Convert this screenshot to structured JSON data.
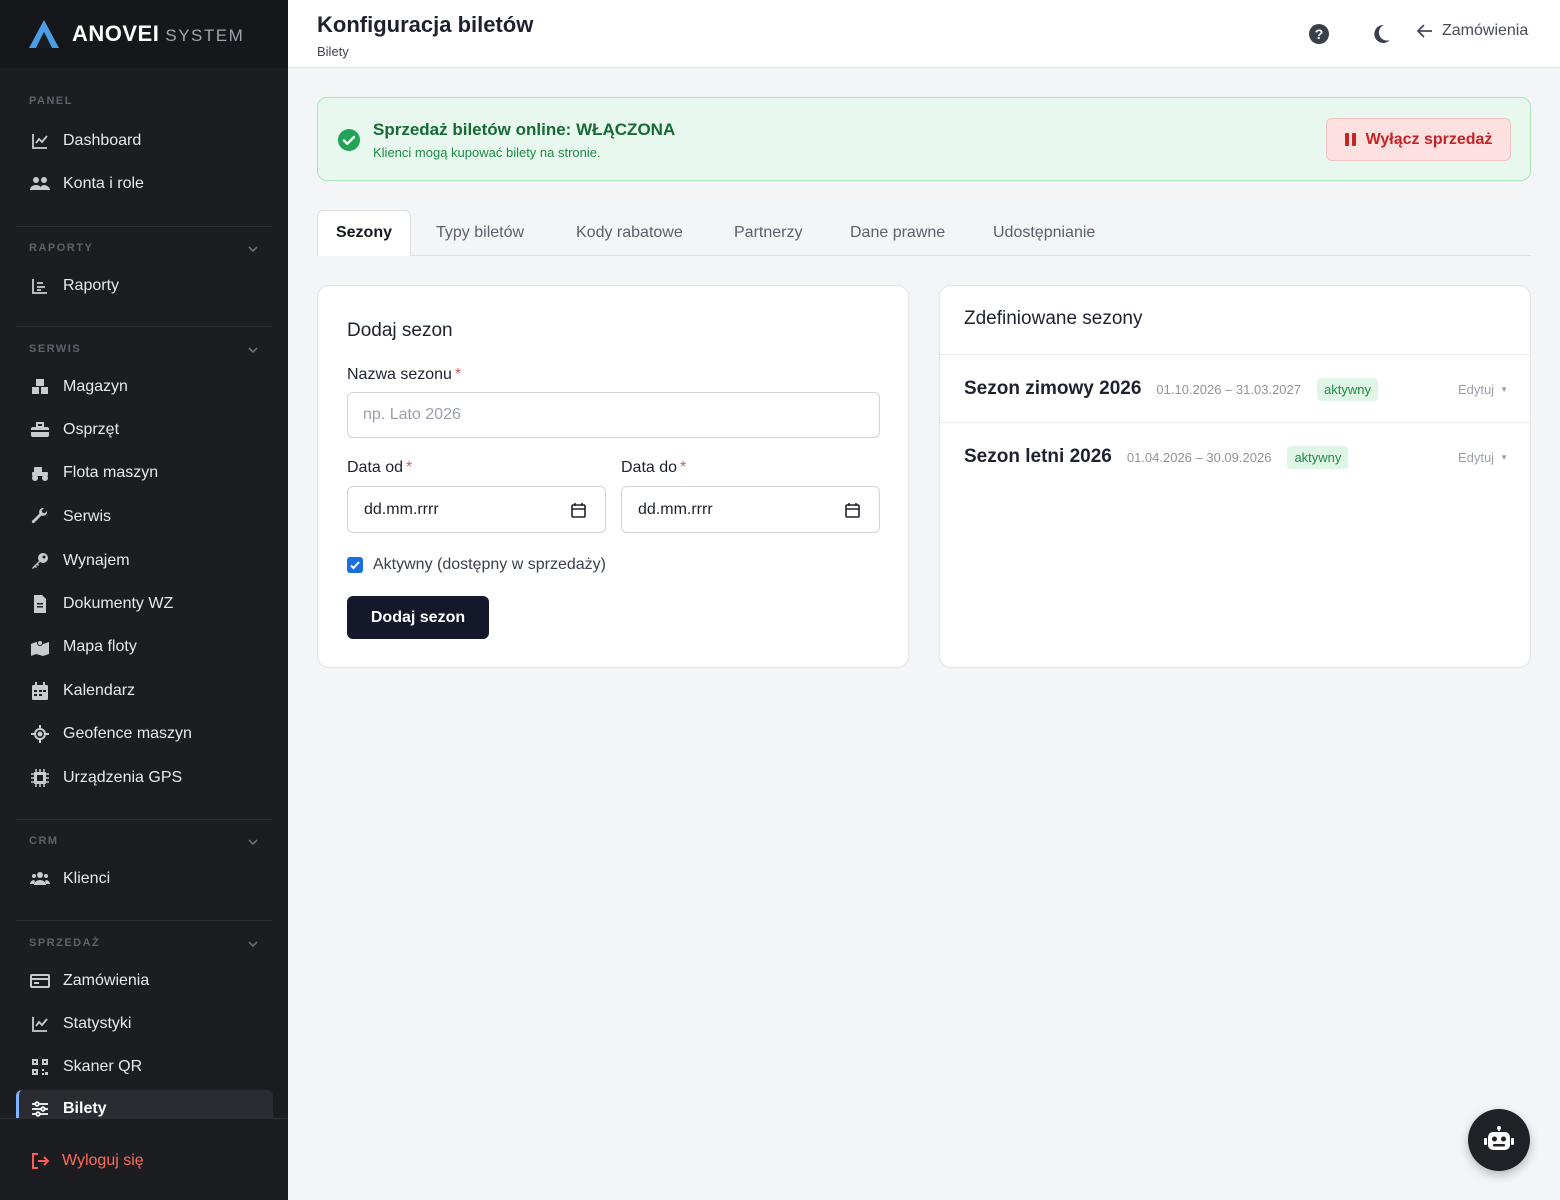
{
  "brand": {
    "name": "ANOVEI",
    "sub": "SYSTEM"
  },
  "sidebar": {
    "sections": {
      "panel": "PANEL",
      "raporty": "RAPORTY",
      "serwis": "SERWIS",
      "crm": "CRM",
      "sprzedaz": "SPRZEDAŻ"
    },
    "items": {
      "dashboard": "Dashboard",
      "konta": "Konta i role",
      "raporty": "Raporty",
      "magazyn": "Magazyn",
      "osprzet": "Osprzęt",
      "flota": "Flota maszyn",
      "serwis": "Serwis",
      "wynajem": "Wynajem",
      "dokumenty": "Dokumenty WZ",
      "mapa": "Mapa floty",
      "kalendarz": "Kalendarz",
      "geofence": "Geofence maszyn",
      "gps": "Urządzenia GPS",
      "klienci": "Klienci",
      "zamowienia": "Zamówienia",
      "statystyki": "Statystyki",
      "skaner": "Skaner QR",
      "bilety": "Bilety"
    },
    "logout": "Wyloguj się"
  },
  "header": {
    "title": "Konfiguracja biletów",
    "subtitle": "Bilety",
    "back_label": "Zamówienia"
  },
  "alert": {
    "title": "Sprzedaż biletów online: WŁĄCZONA",
    "desc": "Klienci mogą kupować bilety na stronie.",
    "button": "Wyłącz sprzedaż"
  },
  "tabs": [
    "Sezony",
    "Typy biletów",
    "Kody rabatowe",
    "Partnerzy",
    "Dane prawne",
    "Udostępnianie"
  ],
  "add_form": {
    "title": "Dodaj sezon",
    "name_label": "Nazwa sezonu",
    "name_placeholder": "np. Lato 2026",
    "from_label": "Data od",
    "to_label": "Data do",
    "date_placeholder": "dd.mm.rrrr",
    "active_label": "Aktywny (dostępny w sprzedaży)",
    "submit": "Dodaj sezon",
    "required_mark": "*"
  },
  "seasons": {
    "title": "Zdefiniowane sezony",
    "items": [
      {
        "name": "Sezon zimowy 2026",
        "dates": "01.10.2026 – 31.03.2027",
        "status": "aktywny",
        "edit": "Edytuj"
      },
      {
        "name": "Sezon letni 2026",
        "dates": "01.04.2026 – 30.09.2026",
        "status": "aktywny",
        "edit": "Edytuj"
      }
    ]
  },
  "colors": {
    "sidebar_bg": "#1c1d21",
    "accent": "#7fb4ff",
    "success": "#1e8a45",
    "danger": "#c42424",
    "primary_button": "#14182a"
  }
}
